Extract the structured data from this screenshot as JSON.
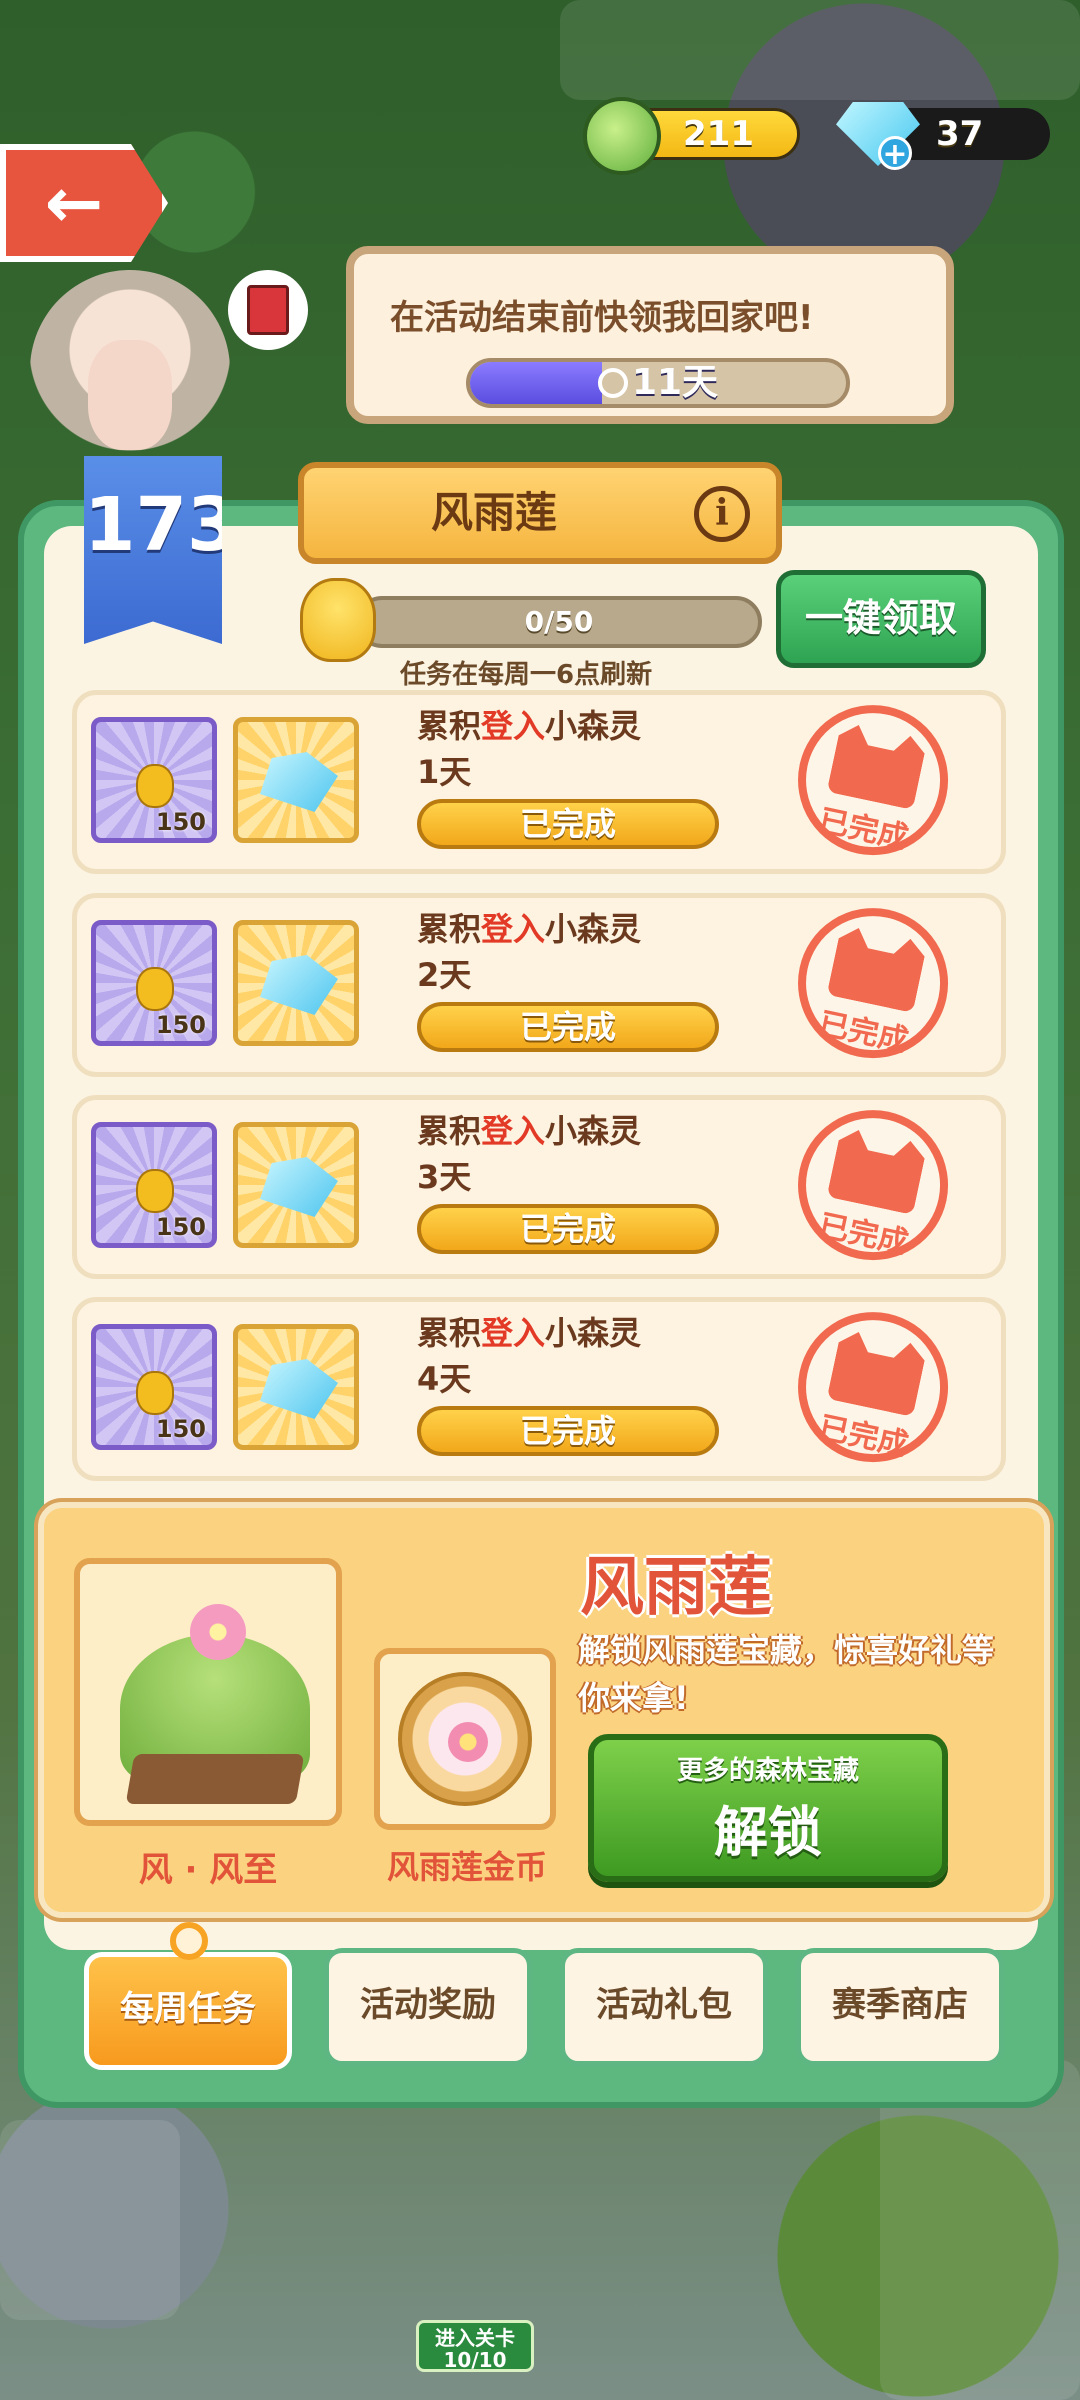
{
  "currency": {
    "leaf_value": "211",
    "gem_value": "37",
    "gem_plus": "+"
  },
  "back_button": {
    "arrow": "←"
  },
  "bubble": {
    "text": "在活动结束前快领我回家吧!",
    "timer_label": "11天",
    "timer_fraction": 0.35
  },
  "level": {
    "number": "173"
  },
  "event": {
    "title": "风雨莲",
    "info": "i",
    "progress_label": "0/50",
    "refresh_note": "任务在每周一6点刷新",
    "claim_all": "一键领取"
  },
  "tasks": [
    {
      "prefix": "累积",
      "highlight": "登入",
      "suffix": "小森灵",
      "days": "1天",
      "reward_count": "150",
      "button": "已完成",
      "stamp": "已完成"
    },
    {
      "prefix": "累积",
      "highlight": "登入",
      "suffix": "小森灵",
      "days": "2天",
      "reward_count": "150",
      "button": "已完成",
      "stamp": "已完成"
    },
    {
      "prefix": "累积",
      "highlight": "登入",
      "suffix": "小森灵",
      "days": "3天",
      "reward_count": "150",
      "button": "已完成",
      "stamp": "已完成"
    },
    {
      "prefix": "累积",
      "highlight": "登入",
      "suffix": "小森灵",
      "days": "4天",
      "reward_count": "150",
      "button": "已完成",
      "stamp": "已完成"
    }
  ],
  "treasure": {
    "title": "风雨莲",
    "description": "解锁风雨莲宝藏，惊喜好礼等你来拿!",
    "house_label": "风 · 风至",
    "coin_label": "风雨莲金币",
    "unlock_sub": "更多的森林宝藏",
    "unlock_main": "解锁"
  },
  "tabs": [
    {
      "label": "每周任务",
      "active": true
    },
    {
      "label": "活动奖励",
      "active": false
    },
    {
      "label": "活动礼包",
      "active": false
    },
    {
      "label": "赛季商店",
      "active": false
    }
  ],
  "world": {
    "enter_level": "进入关卡",
    "enter_level_sub": "10/10"
  }
}
